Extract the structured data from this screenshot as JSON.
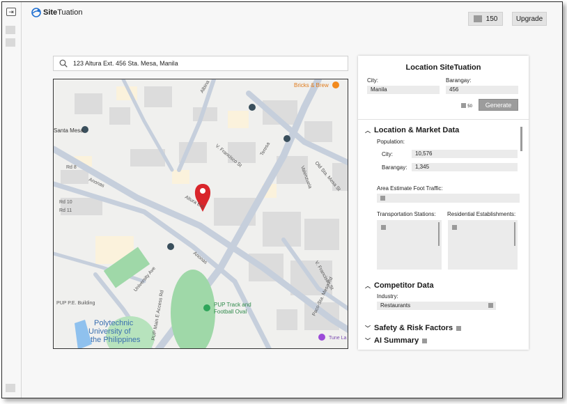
{
  "app": {
    "brand_bold": "Site",
    "brand_rest": "Tuation",
    "credits": "150",
    "upgrade_label": "Upgrade"
  },
  "search": {
    "value": "123 Altura Ext. 456 Sta. Mesa, Manila"
  },
  "map": {
    "labels": {
      "bricks": "Bricks & Brew",
      "albina": "Albina",
      "santa_mesa": "Santa Mesa",
      "vfrancisco1": "V. Francisco St",
      "teresa": "Teresa",
      "oldsta": "Old Sta. Mesa St",
      "valenzuela": "Valenzuela",
      "rd8": "Rd 8",
      "rd10": "Rd 10",
      "rd11": "Rd 11",
      "anonas1": "Anonas",
      "anonas2": "Anonas",
      "altura": "Altura Ext",
      "univ_ave": "University Ave",
      "vfrancisco2": "V. Francisco St",
      "pup_pe": "PUP P.E. Building",
      "pup_main": "PUP Main E Access Rd",
      "pup_track": "PUP Track and",
      "pup_track2": "Football Oval",
      "pup1": "Polytechnic",
      "pup2": "University of",
      "pup3": "the Philippines",
      "paco": "Paco-Sta. Mesa Rd",
      "tune": "Tune La"
    },
    "colors": {
      "pin": "#d9252b",
      "park": "#9fd8a8",
      "road": "#c6cfdc",
      "water": "#8fc1ee"
    }
  },
  "panel": {
    "title": "Location SiteTuation",
    "city_label": "City:",
    "city_value": "Manila",
    "barangay_label": "Barangay:",
    "barangay_value": "456",
    "generate_cost": "50",
    "generate_label": "Generate",
    "market": {
      "title": "Location & Market Data",
      "population_label": "Population:",
      "city_label": "City:",
      "city_value": "10,576",
      "barangay_label": "Barangay:",
      "barangay_value": "1,345",
      "foot_traffic_label": "Area Estimate Foot Traffic:",
      "transport_label": "Transportation Stations:",
      "residential_label": "Residential Establishments:"
    },
    "competitor": {
      "title": "Competitor Data",
      "industry_label": "Industry:",
      "industry_value": "Restaurants"
    },
    "safety": {
      "title": "Safety & Risk Factors"
    },
    "ai": {
      "title": "AI Summary"
    }
  }
}
